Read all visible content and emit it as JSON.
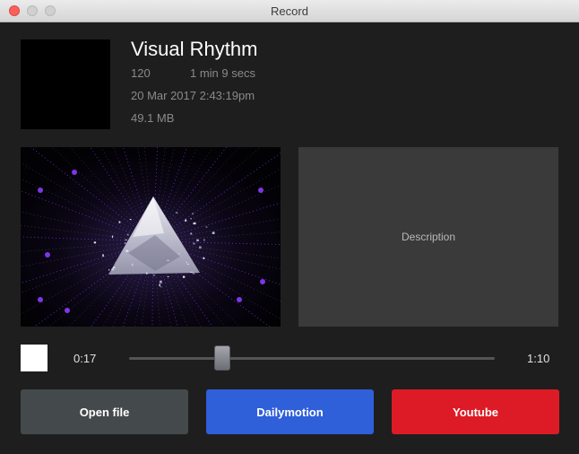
{
  "window": {
    "title": "Record"
  },
  "track": {
    "title": "Visual Rhythm",
    "bpm": "120",
    "duration": "1 min 9 secs",
    "date": "20 Mar 2017 2:43:19pm",
    "size": "49.1 MB"
  },
  "description_label": "Description",
  "player": {
    "current_time": "0:17",
    "total_time": "1:10",
    "progress": 0.255
  },
  "buttons": {
    "open_file": "Open file",
    "dailymotion": "Dailymotion",
    "youtube": "Youtube"
  },
  "colors": {
    "close": "#fc605b",
    "open_file_bg": "#44494c",
    "dailymotion_bg": "#2f5fd9",
    "youtube_bg": "#dd1b26",
    "glow": "#8a3cff"
  }
}
